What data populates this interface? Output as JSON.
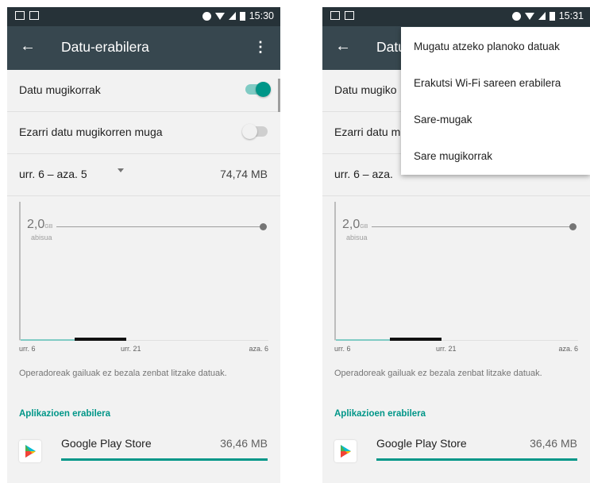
{
  "screen1": {
    "status": {
      "time": "15:30"
    },
    "appbar": {
      "title": "Datu-erabilera",
      "back_icon": "arrow-left-icon",
      "menu_icon": "more-vert-icon"
    },
    "rows": [
      {
        "label": "Datu mugikorrak",
        "toggle": "on"
      },
      {
        "label": "Ezarri datu mugikorren muga",
        "toggle": "off"
      }
    ],
    "cycle": {
      "range": "urr. 6 – aza. 5",
      "total": "74,74 MB"
    },
    "chart": {
      "limit_value": "2,0",
      "limit_unit": "GB",
      "limit_label": "abisua",
      "x_labels": [
        "urr. 6",
        "urr. 21",
        "aza. 6"
      ]
    },
    "note": "Operadoreak gailuak ez bezala zenbat litzake datuak.",
    "section": "Aplikazioen erabilera",
    "app": {
      "name": "Google Play Store",
      "size": "36,46 MB",
      "icon": "play-store-icon"
    }
  },
  "screen2": {
    "status": {
      "time": "15:31"
    },
    "appbar": {
      "title": "Datu",
      "back_icon": "arrow-left-icon"
    },
    "rows": [
      {
        "label": "Datu mugiko"
      },
      {
        "label": "Ezarri datu m"
      }
    ],
    "cycle": {
      "range": "urr. 6 – aza."
    },
    "menu": [
      "Mugatu atzeko planoko datuak",
      "Erakutsi Wi-Fi sareen erabilera",
      "Sare-mugak",
      "Sare mugikorrak"
    ],
    "chart": {
      "limit_value": "2,0",
      "limit_unit": "GB",
      "limit_label": "abisua",
      "x_labels": [
        "urr. 6",
        "urr. 21",
        "aza. 6"
      ]
    },
    "note": "Operadoreak gailuak ez bezala zenbat litzake datuak.",
    "section": "Aplikazioen erabilera",
    "app": {
      "name": "Google Play Store",
      "size": "36,46 MB",
      "icon": "play-store-icon"
    }
  },
  "colors": {
    "accent": "#009688",
    "appbar": "#37474f",
    "statusbar": "#263238"
  }
}
